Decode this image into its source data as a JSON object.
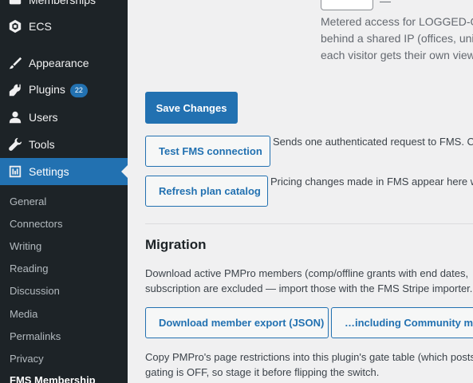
{
  "sidebar": {
    "items": [
      {
        "label": "Memberships",
        "icon": "members-icon"
      },
      {
        "label": "ECS",
        "icon": "ecs-icon"
      },
      {
        "label": "Appearance",
        "icon": "paintbrush-icon"
      },
      {
        "label": "Plugins",
        "icon": "plugin-icon",
        "badge": "22"
      },
      {
        "label": "Users",
        "icon": "user-icon"
      },
      {
        "label": "Tools",
        "icon": "wrench-icon"
      },
      {
        "label": "Settings",
        "icon": "settings-icon",
        "active": true
      }
    ],
    "submenu": [
      {
        "label": "General"
      },
      {
        "label": "Connectors"
      },
      {
        "label": "Writing"
      },
      {
        "label": "Reading"
      },
      {
        "label": "Discussion"
      },
      {
        "label": "Media"
      },
      {
        "label": "Permalinks"
      },
      {
        "label": "Privacy"
      },
      {
        "label": "FMS Membership",
        "current": true
      }
    ]
  },
  "main": {
    "metered": {
      "suffix": "—",
      "desc_lines": [
        "Metered access for LOGGED-O",
        "behind a shared IP (offices, uni",
        "each visitor gets their own view"
      ]
    },
    "save_button": "Save Changes",
    "test_button": "Test FMS connection",
    "test_help": "Sends one authenticated request to FMS. Cr",
    "refresh_button": "Refresh plan catalog",
    "refresh_help": "Pricing changes made in FMS appear here w",
    "migration": {
      "heading": "Migration",
      "desc_lines": [
        "Download active PMPro members (comp/offline grants with end dates,",
        "subscription are excluded — import those with the FMS Stripe importer."
      ],
      "export_button": "Download member export (JSON)",
      "community_button": "…including Community mem",
      "restrict_lines": [
        "Copy PMPro's page restrictions into this plugin's gate table (which posts",
        "gating is OFF, so stage it before flipping the switch."
      ]
    }
  },
  "colors": {
    "sidebar_bg": "#1d2327",
    "accent": "#2271b1",
    "page_bg": "#f0f0f1"
  }
}
